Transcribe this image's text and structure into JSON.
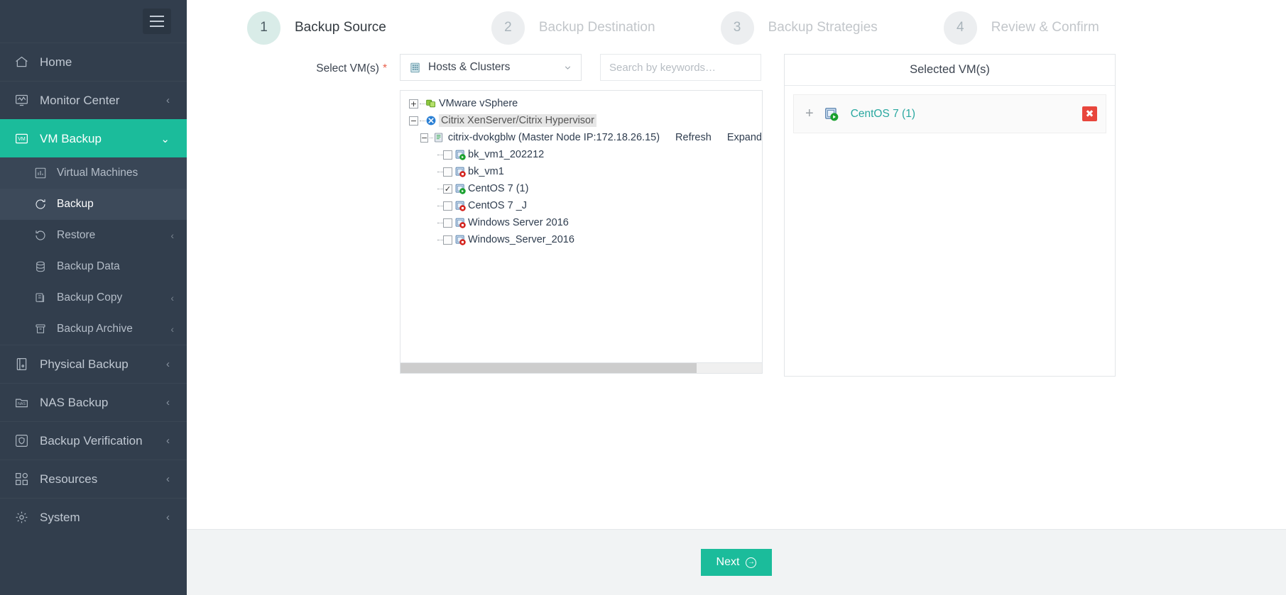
{
  "sidebar": {
    "menu_icon": "hamburger-icon",
    "items": [
      {
        "label": "Home",
        "icon": "home-icon",
        "caret": "",
        "state": "normal"
      },
      {
        "label": "Monitor Center",
        "icon": "monitor-icon",
        "caret": "‹",
        "state": "normal"
      },
      {
        "label": "VM Backup",
        "icon": "vm-icon",
        "caret": "⌄",
        "state": "active"
      }
    ],
    "sub_items": [
      {
        "label": "Virtual Machines",
        "icon": "chart-icon",
        "caret": "",
        "state": "hover"
      },
      {
        "label": "Backup",
        "icon": "backup-icon",
        "caret": "",
        "state": "selected"
      },
      {
        "label": "Restore",
        "icon": "restore-icon",
        "caret": "‹",
        "state": "normal"
      },
      {
        "label": "Backup Data",
        "icon": "database-icon",
        "caret": "",
        "state": "normal"
      },
      {
        "label": "Backup Copy",
        "icon": "copy-icon",
        "caret": "‹",
        "state": "normal"
      },
      {
        "label": "Backup Archive",
        "icon": "archive-icon",
        "caret": "‹",
        "state": "normal"
      }
    ],
    "bottom_items": [
      {
        "label": "Physical Backup",
        "icon": "server-icon",
        "caret": "‹"
      },
      {
        "label": "NAS Backup",
        "icon": "nas-icon",
        "caret": "‹"
      },
      {
        "label": "Backup Verification",
        "icon": "shield-check-icon",
        "caret": "‹"
      },
      {
        "label": "Resources",
        "icon": "grid-icon",
        "caret": "‹"
      },
      {
        "label": "System",
        "icon": "gear-icon",
        "caret": "‹"
      }
    ]
  },
  "wizard": {
    "steps": [
      {
        "num": "1",
        "label": "Backup Source",
        "active": true
      },
      {
        "num": "2",
        "label": "Backup Destination",
        "active": false
      },
      {
        "num": "3",
        "label": "Backup Strategies",
        "active": false
      },
      {
        "num": "4",
        "label": "Review & Confirm",
        "active": false
      }
    ]
  },
  "form": {
    "field_label": "Select VM(s)",
    "required_mark": "*",
    "source_select": {
      "value": "Hosts & Clusters",
      "icon": "building-icon",
      "caret": "⌄"
    },
    "search": {
      "value": "",
      "placeholder": "Search by keywords…"
    }
  },
  "tree": {
    "links": {
      "refresh": "Refresh",
      "expand": "Expand"
    },
    "nodes": [
      {
        "label": "VMware vSphere",
        "toggle": "+",
        "icon": "vsphere-icon",
        "level": 0,
        "checkbox": false,
        "checked": false,
        "highlighted": false
      },
      {
        "label": "Citrix XenServer/Citrix Hypervisor",
        "toggle": "−",
        "icon": "citrix-icon",
        "level": 0,
        "checkbox": false,
        "checked": false,
        "highlighted": true
      },
      {
        "label": "citrix-dvokgblw (Master Node IP:172.18.26.15)",
        "toggle": "−",
        "icon": "host-icon",
        "level": 1,
        "checkbox": false,
        "checked": false,
        "highlighted": false
      },
      {
        "label": "bk_vm1_202212",
        "toggle": "",
        "icon": "vm-running-icon",
        "level": 2,
        "checkbox": true,
        "checked": false,
        "highlighted": false
      },
      {
        "label": "bk_vm1",
        "toggle": "",
        "icon": "vm-stopped-icon",
        "level": 2,
        "checkbox": true,
        "checked": false,
        "highlighted": false
      },
      {
        "label": "CentOS 7 (1)",
        "toggle": "",
        "icon": "vm-running-icon",
        "level": 2,
        "checkbox": true,
        "checked": true,
        "highlighted": false
      },
      {
        "label": "CentOS 7 _J",
        "toggle": "",
        "icon": "vm-stopped-icon",
        "level": 2,
        "checkbox": true,
        "checked": false,
        "highlighted": false
      },
      {
        "label": "Windows Server 2016",
        "toggle": "",
        "icon": "vm-stopped-icon",
        "level": 2,
        "checkbox": true,
        "checked": false,
        "highlighted": false
      },
      {
        "label": "Windows_Server_2016",
        "toggle": "",
        "icon": "vm-stopped-icon",
        "level": 2,
        "checkbox": true,
        "checked": false,
        "highlighted": false
      }
    ]
  },
  "selected_panel": {
    "title": "Selected VM(s)",
    "items": [
      {
        "name": "CentOS 7 (1)",
        "icon": "vm-running-icon",
        "add_icon": "plus-icon",
        "delete_icon": "close-icon",
        "delete_label": "✖"
      }
    ]
  },
  "footer": {
    "next_label": "Next",
    "next_arrow": "→"
  },
  "colors": {
    "sidebar_bg": "#323e4d",
    "accent": "#1bbc9b",
    "step_active_circle": "#d9ece8",
    "danger": "#e8463c",
    "link_teal": "#2aa8a0"
  }
}
